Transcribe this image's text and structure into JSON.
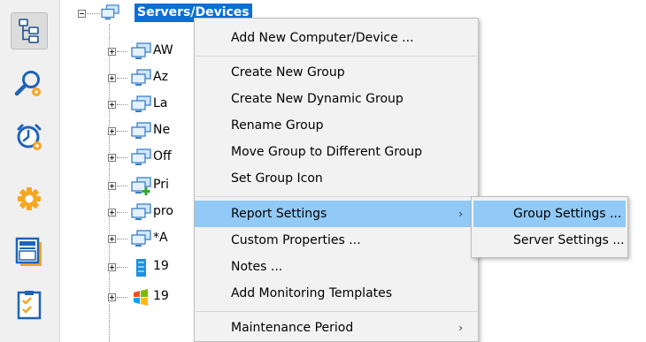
{
  "toolbar": {
    "buttons": [
      {
        "name": "tree-view-icon",
        "selected": true
      },
      {
        "name": "search-settings-icon"
      },
      {
        "name": "alarm-settings-icon"
      },
      {
        "name": "gear-icon"
      },
      {
        "name": "news-report-icon"
      },
      {
        "name": "checklist-icon"
      }
    ]
  },
  "tree": {
    "root_label": "Servers/Devices",
    "children": [
      {
        "label": "AW",
        "icon": "computer-group-icon"
      },
      {
        "label": "Az",
        "icon": "computer-group-icon"
      },
      {
        "label": "La",
        "icon": "computer-group-icon"
      },
      {
        "label": "Ne",
        "icon": "computer-group-icon"
      },
      {
        "label": "Off",
        "icon": "computer-group-icon"
      },
      {
        "label": "Pri",
        "icon": "computer-group-add-icon"
      },
      {
        "label": "pro",
        "icon": "computer-group-icon"
      },
      {
        "label": "*A",
        "icon": "computer-group-icon"
      },
      {
        "label": "19",
        "icon": "server-icon"
      },
      {
        "label": "19",
        "icon": "windows-logo-icon"
      }
    ]
  },
  "context_menu": {
    "items": [
      {
        "label": "Add New Computer/Device ..."
      },
      {
        "label": "Create New Group"
      },
      {
        "label": "Create New Dynamic Group"
      },
      {
        "label": "Rename Group"
      },
      {
        "label": "Move Group to Different Group"
      },
      {
        "label": "Set Group Icon"
      },
      {
        "label": "Report Settings",
        "submenu": true,
        "highlighted": true
      },
      {
        "label": "Custom Properties ..."
      },
      {
        "label": "Notes ..."
      },
      {
        "label": "Add Monitoring Templates"
      },
      {
        "label": "Maintenance Period",
        "submenu": true
      }
    ],
    "submenu_arrow": "›"
  },
  "submenu": {
    "items": [
      {
        "label": "Group Settings ...",
        "highlighted": true
      },
      {
        "label": "Server Settings ..."
      }
    ]
  },
  "colors": {
    "selection_blue": "#0a6fd6",
    "menu_hover": "#91c9f7",
    "menu_bg": "#f2f2f2",
    "toolbar_bg": "#f0f0f0",
    "icon_orange": "#f5a623",
    "icon_blue": "#1f63b8"
  }
}
